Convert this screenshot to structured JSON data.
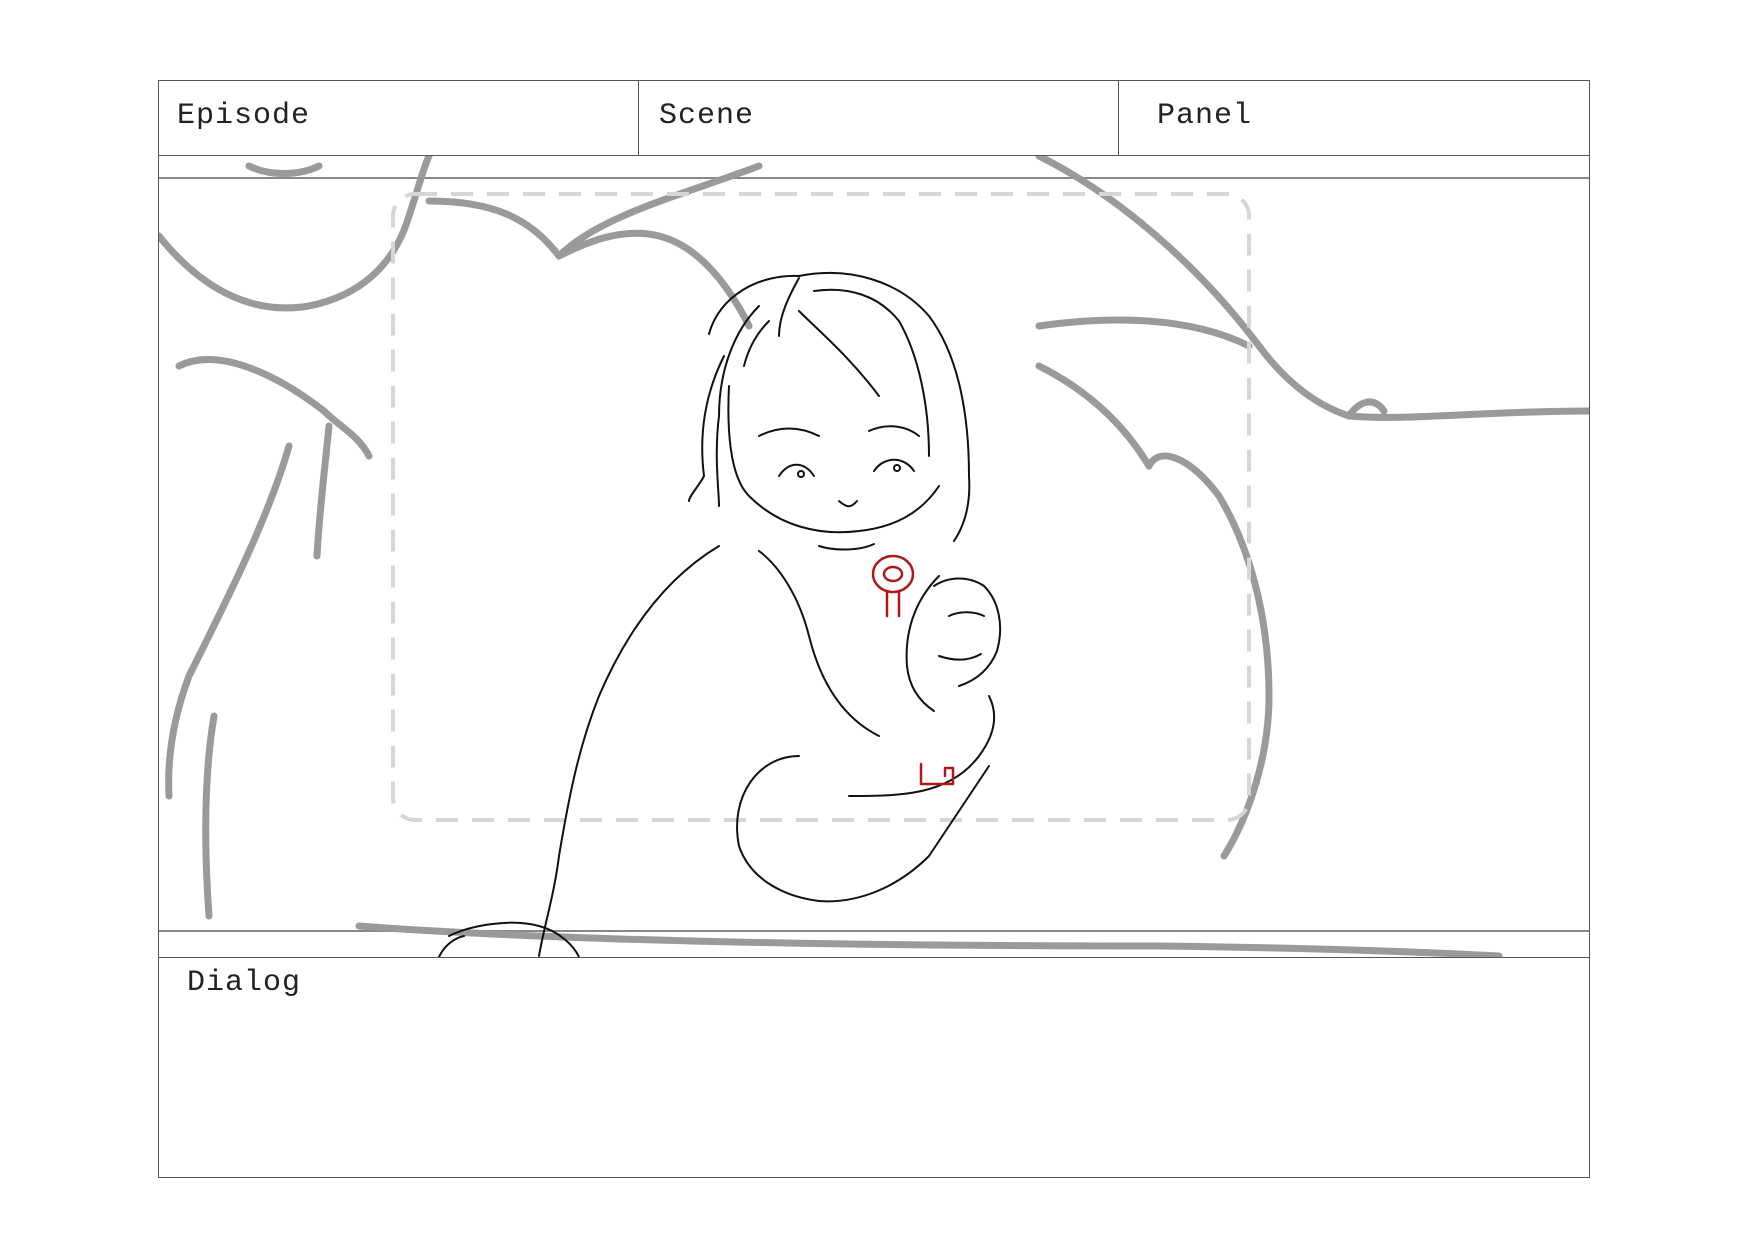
{
  "header": {
    "episode_label": "Episode",
    "scene_label": "Scene",
    "panel_label": "Panel"
  },
  "panel": {
    "drawing": "sketch-illustration",
    "prop": "key-icon",
    "colors": {
      "sketch": "#111111",
      "background_figures": "#9a9a9a",
      "safe_frame": "#d6d6d6",
      "key": "#b01818"
    }
  },
  "dialog": {
    "label": "Dialog",
    "text": ""
  }
}
